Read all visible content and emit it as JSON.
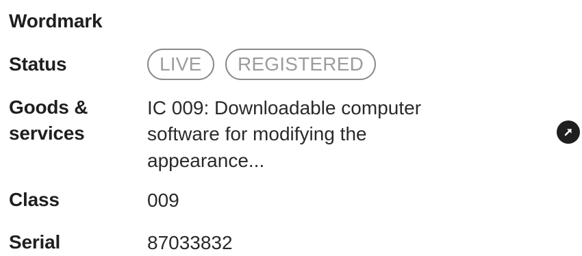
{
  "wordmark": {
    "label": "Wordmark"
  },
  "status": {
    "label": "Status",
    "badges": [
      "LIVE",
      "REGISTERED"
    ]
  },
  "goods_services": {
    "label_line1": "Goods &",
    "label_line2": "services",
    "line1": "IC 009: Downloadable computer",
    "line2": "software for modifying the",
    "line3": "appearance..."
  },
  "class": {
    "label": "Class",
    "value": "009"
  },
  "serial": {
    "label": "Serial",
    "value": "87033832"
  },
  "icons": {
    "open_details": "arrow-up-right-icon"
  },
  "colors": {
    "text": "#1f1f1f",
    "badge_border": "#8a8a8a",
    "badge_text": "#9c9c9c",
    "icon_bg": "#1f1f1f"
  }
}
